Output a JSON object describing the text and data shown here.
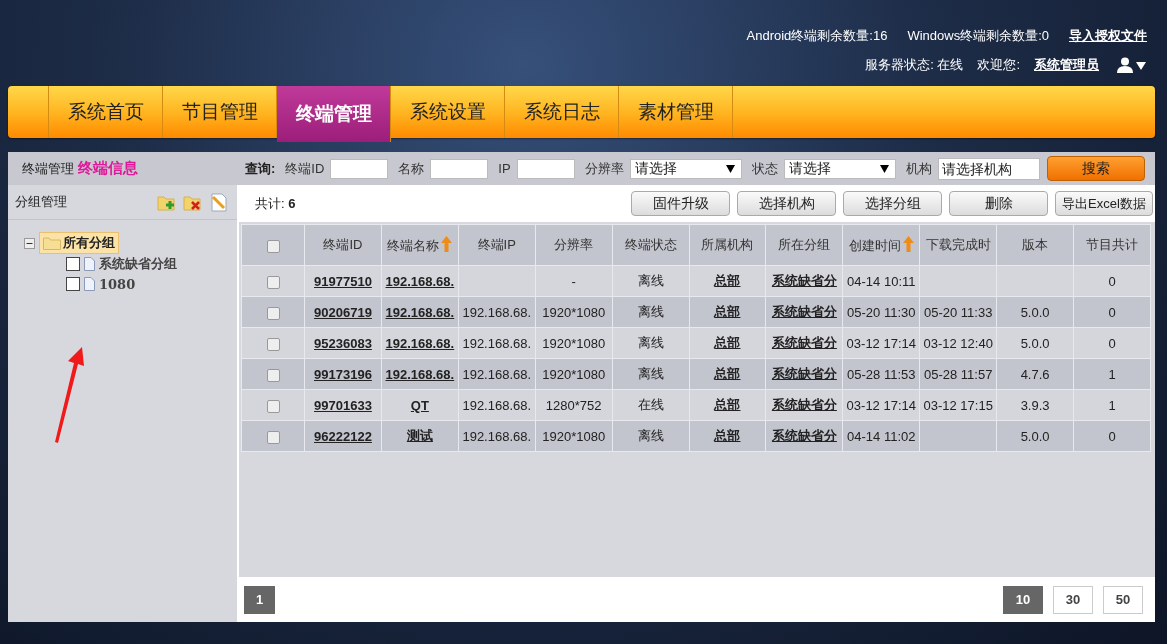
{
  "header": {
    "counters": [
      "Android终端剩余数量:16",
      "Windows终端剩余数量:0"
    ],
    "import_link": "导入授权文件",
    "server_status": "服务器状态: 在线",
    "welcome_label": "欢迎您:",
    "user_name": "系统管理员"
  },
  "nav": [
    {
      "label": "系统首页",
      "selected": false
    },
    {
      "label": "节目管理",
      "selected": false
    },
    {
      "label": "终端管理",
      "selected": true
    },
    {
      "label": "系统设置",
      "selected": false
    },
    {
      "label": "系统日志",
      "selected": false
    },
    {
      "label": "素材管理",
      "selected": false
    }
  ],
  "breadcrumb": {
    "section": "终端管理",
    "page": "终端信息"
  },
  "query": {
    "label": "查询:",
    "fields": [
      {
        "kind": "input",
        "label": "终端ID"
      },
      {
        "kind": "input",
        "label": "名称"
      },
      {
        "kind": "input",
        "label": "IP"
      },
      {
        "kind": "select",
        "label": "分辨率",
        "value": "请选择"
      },
      {
        "kind": "select",
        "label": "状态",
        "value": "请选择"
      },
      {
        "kind": "picker",
        "label": "机构",
        "value": "请选择机构"
      }
    ],
    "search_button": "搜索"
  },
  "sidebar": {
    "title": "分组管理",
    "tree": [
      {
        "label": "所有分组",
        "expanded": true,
        "selected": true,
        "children": [
          {
            "label": "系统缺省分组",
            "checked": false
          },
          {
            "label": "1080",
            "checked": false
          }
        ]
      }
    ]
  },
  "toolbar": {
    "total": "共计: **6**",
    "buttons": [
      "固件升级",
      "选择机构",
      "选择分组",
      "删除",
      "导出Excel数据"
    ]
  },
  "table": {
    "select_all_checked": false,
    "columns": [
      {
        "label": "终端ID",
        "kind": "link",
        "sorted": false
      },
      {
        "label": "终端名称",
        "kind": "link",
        "sorted": true
      },
      {
        "label": "终端IP",
        "kind": "text",
        "sorted": false
      },
      {
        "label": "分辨率",
        "kind": "text",
        "sorted": false
      },
      {
        "label": "终端状态",
        "kind": "text",
        "sorted": false
      },
      {
        "label": "所属机构",
        "kind": "link",
        "sorted": false
      },
      {
        "label": "所在分组",
        "kind": "link",
        "sorted": false
      },
      {
        "label": "创建时间",
        "kind": "text",
        "sorted": true
      },
      {
        "label": "下载完成时",
        "kind": "text",
        "sorted": false
      },
      {
        "label": "版本",
        "kind": "text",
        "sorted": false
      },
      {
        "label": "节目共计",
        "kind": "text",
        "sorted": false
      }
    ],
    "rows": [
      {
        "checked": false,
        "cells": [
          "91977510",
          "192.168.68.",
          "",
          "-",
          "离线",
          "总部",
          "系统缺省分",
          "04-14 10:11",
          "",
          "",
          "0"
        ]
      },
      {
        "checked": false,
        "cells": [
          "90206719",
          "192.168.68.",
          "192.168.68.",
          "1920*1080",
          "离线",
          "总部",
          "系统缺省分",
          "05-20 11:30",
          "05-20 11:33",
          "5.0.0",
          "0"
        ]
      },
      {
        "checked": false,
        "cells": [
          "95236083",
          "192.168.68.",
          "192.168.68.",
          "1920*1080",
          "离线",
          "总部",
          "系统缺省分",
          "03-12 17:14",
          "03-12 12:40",
          "5.0.0",
          "0"
        ]
      },
      {
        "checked": false,
        "cells": [
          "99173196",
          "192.168.68.",
          "192.168.68.",
          "1920*1080",
          "离线",
          "总部",
          "系统缺省分",
          "05-28 11:53",
          "05-28 11:57",
          "4.7.6",
          "1"
        ]
      },
      {
        "checked": false,
        "cells": [
          "99701633",
          "QT",
          "192.168.68.",
          "1280*752",
          "在线",
          "总部",
          "系统缺省分",
          "03-12 17:14",
          "03-12 17:15",
          "3.9.3",
          "1"
        ]
      },
      {
        "checked": false,
        "cells": [
          "96222122",
          "测试",
          "192.168.68.",
          "1920*1080",
          "离线",
          "总部",
          "系统缺省分",
          "04-14 11:02",
          "",
          "5.0.0",
          "0"
        ]
      }
    ]
  },
  "pagination": {
    "pages": [
      {
        "label": "1",
        "selected": true
      }
    ],
    "page_sizes": [
      {
        "label": "10",
        "selected": true
      },
      {
        "label": "30",
        "selected": false
      },
      {
        "label": "50",
        "selected": false
      }
    ]
  }
}
